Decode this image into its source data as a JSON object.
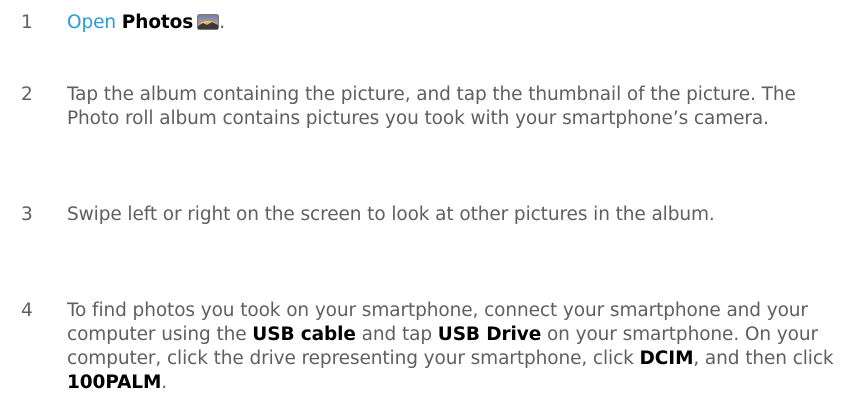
{
  "steps": [
    {
      "number": "1",
      "open_link": "Open",
      "photos_label": "Photos",
      "icon": "photos-app-icon",
      "end": "."
    },
    {
      "number": "2",
      "text": "Tap the album containing the picture, and tap the thumbnail of the picture. The Photo roll album contains pictures you took with your smartphone’s camera."
    },
    {
      "number": "3",
      "text": "Swipe left or right on the screen to look at other pictures in the album."
    },
    {
      "number": "4",
      "t1": "To find photos you took on your smartphone, connect your smartphone and your computer using the ",
      "b1": "USB cable",
      "t2": " and tap ",
      "b2": "USB Drive",
      "t3": " on your smartphone. On your computer, click the drive representing your smartphone, click ",
      "b3": "DCIM",
      "t4": ", and then click ",
      "b4": "100PALM",
      "t5": "."
    }
  ],
  "colors": {
    "body_text": "#5f5f5f",
    "link": "#2b9ad6",
    "bold_text": "#000000"
  }
}
